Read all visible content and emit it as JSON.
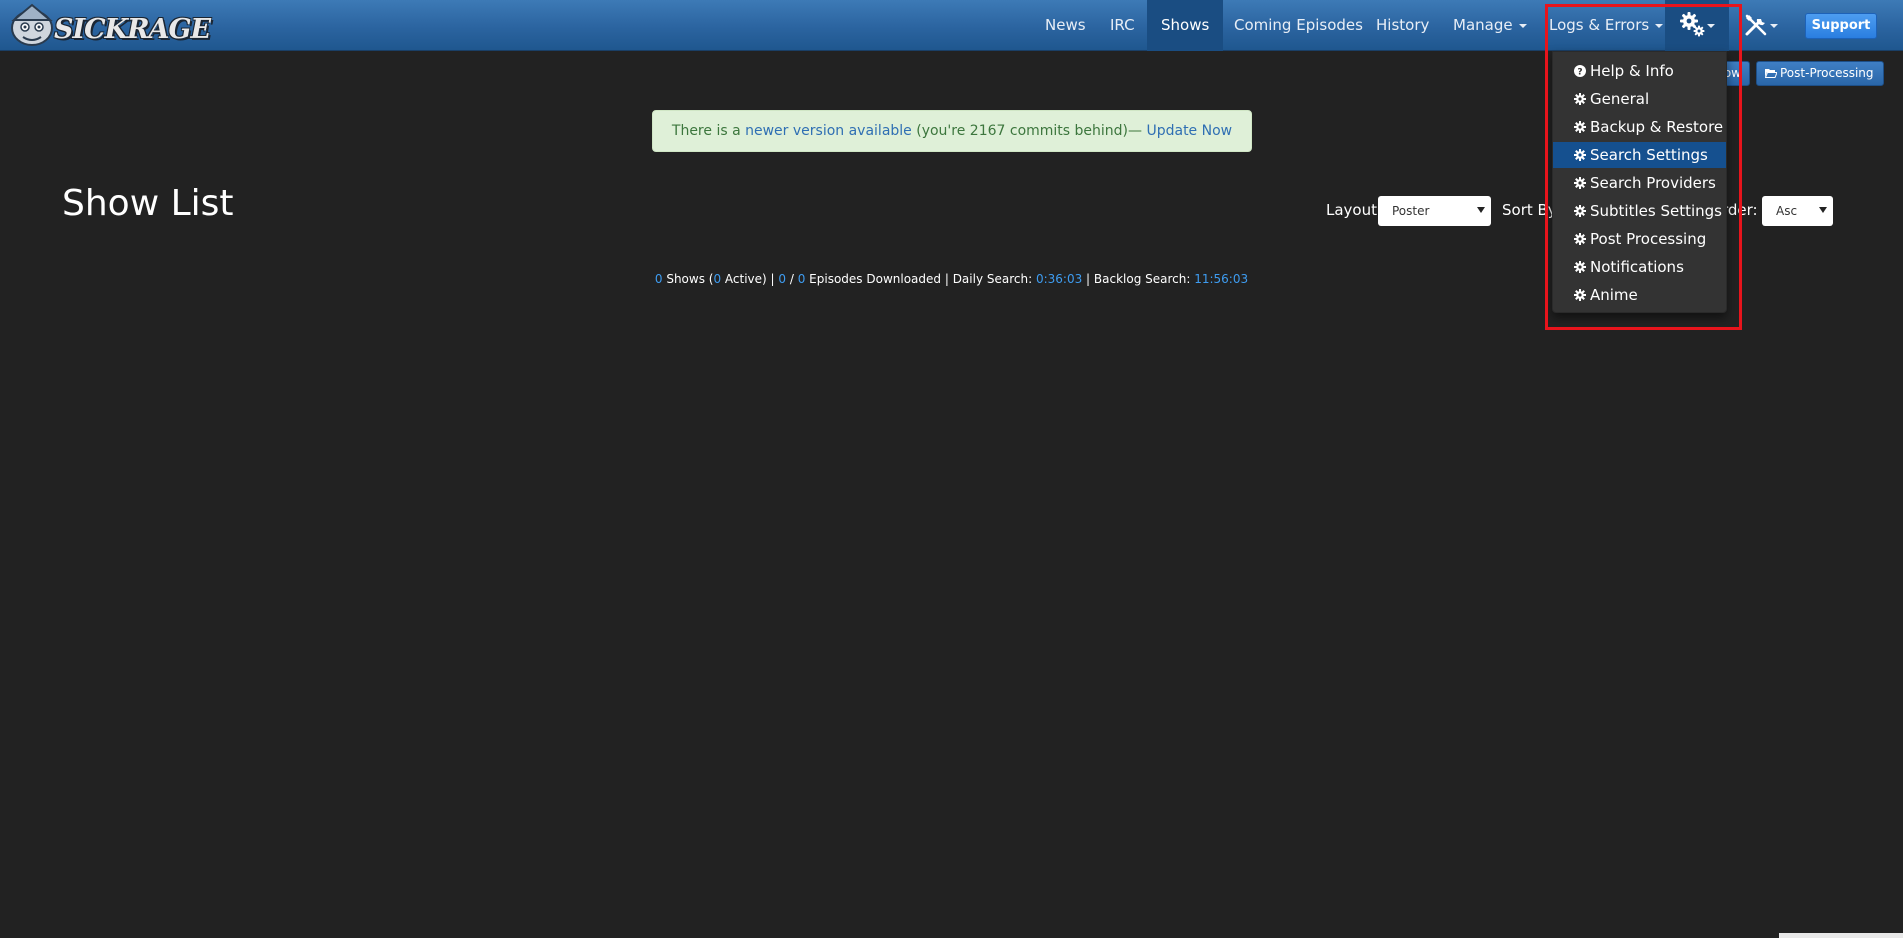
{
  "brand": {
    "name": "SICKRAGE"
  },
  "nav": {
    "items": [
      {
        "label": "News"
      },
      {
        "label": "IRC"
      },
      {
        "label": "Shows"
      },
      {
        "label": "Coming Episodes"
      },
      {
        "label": "History"
      },
      {
        "label": "Manage"
      },
      {
        "label": "Logs & Errors"
      }
    ],
    "gear_icon": "gear-icon",
    "tools_icon": "tools-icon",
    "support_label": "Support"
  },
  "actions": {
    "add_show_partial": "ow",
    "post_processing_label": "Post-Processing"
  },
  "alert": {
    "prefix": "There is a ",
    "newer_link": "newer version available",
    "middle": " (you're 2167 commits behind)— ",
    "update_link": "Update Now"
  },
  "page": {
    "title": "Show List"
  },
  "controls": {
    "layout_label": "Layout:",
    "layout_value": "Poster",
    "sort_label": "Sort By",
    "order_label_partial": "rder:",
    "order_value": "Asc"
  },
  "stats": {
    "shows_count": "0",
    "shows_text": " Shows (",
    "active_count": "0",
    "active_text": " Active) | ",
    "downloaded_count": "0",
    "slash": " / ",
    "episodes_count": "0",
    "episodes_text": " Episodes Downloaded | Daily Search: ",
    "daily_search": "0:36:03",
    "backlog_text": " | Backlog Search: ",
    "backlog_search": "11:56:03"
  },
  "config_menu": {
    "items": [
      {
        "label": "Help & Info",
        "icon": "question-circle-icon"
      },
      {
        "label": "General",
        "icon": "cog-icon"
      },
      {
        "label": "Backup & Restore",
        "icon": "cog-icon"
      },
      {
        "label": "Search Settings",
        "icon": "cog-icon"
      },
      {
        "label": "Search Providers",
        "icon": "cog-icon"
      },
      {
        "label": "Subtitles Settings",
        "icon": "cog-icon"
      },
      {
        "label": "Post Processing",
        "icon": "cog-icon"
      },
      {
        "label": "Notifications",
        "icon": "cog-icon"
      },
      {
        "label": "Anime",
        "icon": "cog-icon"
      }
    ],
    "active_index": 3
  },
  "colors": {
    "navbar": "#2b64a0",
    "nav_active": "#1a4d82",
    "background": "#222222",
    "accent_link": "#3e9cf0",
    "menu_active": "#15508f",
    "highlight": "#e8141c"
  }
}
